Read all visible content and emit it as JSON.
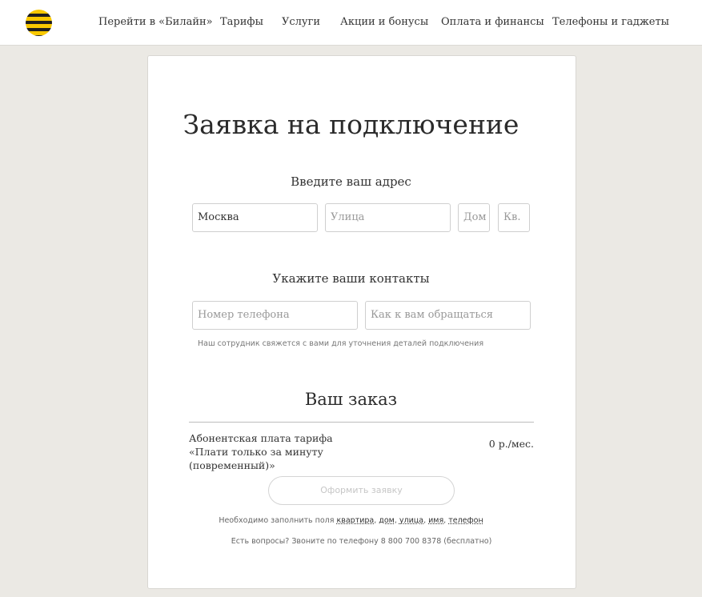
{
  "header": {
    "nav": [
      "Перейти в «Билайн»",
      "Тарифы",
      "Услуги",
      "Акции и бонусы",
      "Оплата и финансы",
      "Телефоны и гаджеты"
    ],
    "logo_icon": "beeline-striped-logo-icon"
  },
  "form": {
    "title": "Заявка на подключение",
    "address_title": "Введите ваш адрес",
    "city_value": "Москва",
    "street_placeholder": "Улица",
    "house_placeholder": "Дом",
    "apartment_placeholder": "Кв.",
    "contacts_title": "Укажите ваши контакты",
    "phone_placeholder": "Номер телефона",
    "name_placeholder": "Как к вам обращаться",
    "hint": "Наш сотрудник свяжется с вами для уточнения деталей подключения"
  },
  "order": {
    "title": "Ваш заказ",
    "item_description": "Абонентская плата тарифа «Плати только за минуту (повременный)»",
    "item_price": "0 р./мес.",
    "submit_label": "Оформить заявку",
    "required_prefix": "Необходимо заполнить поля",
    "required_fields": [
      "квартира",
      "дом",
      "улица",
      "имя",
      "телефон"
    ],
    "questions": "Есть вопросы? Звоните по телефону 8 800 700 8378 (бесплатно)"
  },
  "colors": {
    "brand_yellow": "#f8c800",
    "brand_black": "#1f1f1f",
    "page_background": "#ebe9e4"
  }
}
